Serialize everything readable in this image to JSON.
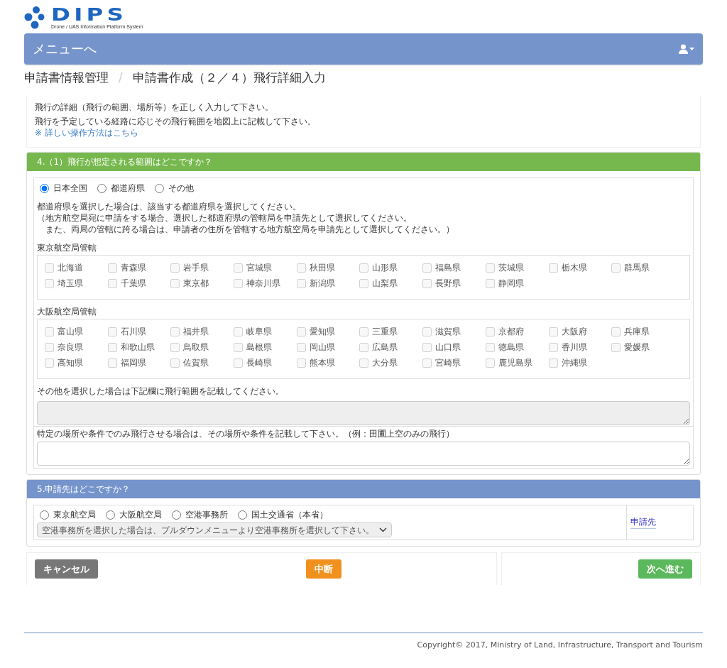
{
  "header": {
    "logo_text": "DIPS",
    "logo_subtitle": "Drone / UAS Information Platform System",
    "menu_link": "メニューへ"
  },
  "breadcrumb": {
    "items": [
      "申請書情報管理",
      "申請書作成（２／４）飛行詳細入力"
    ],
    "separator": "/"
  },
  "intro": {
    "lines": [
      "飛行の詳細（飛行の範囲、場所等）を正しく入力して下さい。",
      "飛行を予定している経路に応じその飛行範囲を地図上に記載して下さい。"
    ],
    "help_link": "※ 詳しい操作方法はこちら"
  },
  "section_4": {
    "title": "4.（1）飛行が想定される範囲はどこですか？",
    "scope_options": [
      {
        "label": "日本全国",
        "selected": true
      },
      {
        "label": "都道府県",
        "selected": false
      },
      {
        "label": "その他",
        "selected": false
      }
    ],
    "notes": [
      "都道府県を選択した場合は、該当する都道府県を選択してください。",
      "（地方航空局宛に申請をする場合、選択した都道府県の管轄局を申請先として選択してください。",
      "　また、両局の管轄に跨る場合は、申請者の住所を管轄する地方航空局を申請先として選択してください。）"
    ],
    "bureaus": [
      {
        "title": "東京航空局管轄",
        "prefectures": [
          {
            "label": "北海道",
            "checked": false,
            "disabled": true
          },
          {
            "label": "青森県",
            "checked": false,
            "disabled": true
          },
          {
            "label": "岩手県",
            "checked": false,
            "disabled": true
          },
          {
            "label": "宮城県",
            "checked": false,
            "disabled": true
          },
          {
            "label": "秋田県",
            "checked": false,
            "disabled": true
          },
          {
            "label": "山形県",
            "checked": false,
            "disabled": true
          },
          {
            "label": "福島県",
            "checked": false,
            "disabled": true
          },
          {
            "label": "茨城県",
            "checked": false,
            "disabled": true
          },
          {
            "label": "栃木県",
            "checked": false,
            "disabled": true
          },
          {
            "label": "群馬県",
            "checked": false,
            "disabled": true
          },
          {
            "label": "埼玉県",
            "checked": false,
            "disabled": true
          },
          {
            "label": "千葉県",
            "checked": false,
            "disabled": true
          },
          {
            "label": "東京都",
            "checked": false,
            "disabled": true
          },
          {
            "label": "神奈川県",
            "checked": false,
            "disabled": true
          },
          {
            "label": "新潟県",
            "checked": false,
            "disabled": true
          },
          {
            "label": "山梨県",
            "checked": false,
            "disabled": true
          },
          {
            "label": "長野県",
            "checked": false,
            "disabled": true
          },
          {
            "label": "静岡県",
            "checked": false,
            "disabled": true
          }
        ]
      },
      {
        "title": "大阪航空局管轄",
        "prefectures": [
          {
            "label": "富山県",
            "checked": false,
            "disabled": true
          },
          {
            "label": "石川県",
            "checked": false,
            "disabled": true
          },
          {
            "label": "福井県",
            "checked": false,
            "disabled": true
          },
          {
            "label": "岐阜県",
            "checked": false,
            "disabled": true
          },
          {
            "label": "愛知県",
            "checked": false,
            "disabled": true
          },
          {
            "label": "三重県",
            "checked": false,
            "disabled": true
          },
          {
            "label": "滋賀県",
            "checked": false,
            "disabled": true
          },
          {
            "label": "京都府",
            "checked": false,
            "disabled": true
          },
          {
            "label": "大阪府",
            "checked": false,
            "disabled": true
          },
          {
            "label": "兵庫県",
            "checked": false,
            "disabled": true
          },
          {
            "label": "奈良県",
            "checked": false,
            "disabled": true
          },
          {
            "label": "和歌山県",
            "checked": false,
            "disabled": true
          },
          {
            "label": "鳥取県",
            "checked": false,
            "disabled": true
          },
          {
            "label": "島根県",
            "checked": false,
            "disabled": true
          },
          {
            "label": "岡山県",
            "checked": false,
            "disabled": true
          },
          {
            "label": "広島県",
            "checked": false,
            "disabled": true
          },
          {
            "label": "山口県",
            "checked": false,
            "disabled": true
          },
          {
            "label": "徳島県",
            "checked": false,
            "disabled": true
          },
          {
            "label": "香川県",
            "checked": false,
            "disabled": true
          },
          {
            "label": "愛媛県",
            "checked": false,
            "disabled": true
          },
          {
            "label": "高知県",
            "checked": false,
            "disabled": true
          },
          {
            "label": "福岡県",
            "checked": false,
            "disabled": true
          },
          {
            "label": "佐賀県",
            "checked": false,
            "disabled": true
          },
          {
            "label": "長崎県",
            "checked": false,
            "disabled": true
          },
          {
            "label": "熊本県",
            "checked": false,
            "disabled": true
          },
          {
            "label": "大分県",
            "checked": false,
            "disabled": true
          },
          {
            "label": "宮崎県",
            "checked": false,
            "disabled": true
          },
          {
            "label": "鹿児島県",
            "checked": false,
            "disabled": true
          },
          {
            "label": "沖縄県",
            "checked": false,
            "disabled": true
          }
        ]
      }
    ],
    "other_note": "その他を選択した場合は下記欄に飛行範囲を記載してください。",
    "other_field": {
      "disabled": true
    },
    "condition_note": "特定の場所や条件でのみ飛行させる場合は、その場所や条件を記載して下さい。（例：田圃上空のみの飛行）",
    "condition_field": {
      "disabled": false
    }
  },
  "section_5": {
    "title": "5.申請先はどこですか？",
    "options": [
      {
        "label": "東京航空局",
        "selected": false
      },
      {
        "label": "大阪航空局",
        "selected": false
      },
      {
        "label": "空港事務所",
        "selected": false
      },
      {
        "label": "国土交通省（本省）",
        "selected": false
      }
    ],
    "dropdown": {
      "value": "空港事務所を選択した場合は、プルダウンメニューより空港事務所を選択して下さい。"
    },
    "destination_link": "申請先"
  },
  "button_bar": {
    "left": [
      {
        "label": "キャンセル",
        "kind": "cancel"
      },
      {
        "label": "中断",
        "kind": "suspend"
      }
    ],
    "right": [
      {
        "label": "次へ進む",
        "kind": "next"
      }
    ]
  },
  "footer": {
    "copyright": "Copyright© 2017, Ministry of Land, Infrastructure, Transport and Tourism"
  }
}
